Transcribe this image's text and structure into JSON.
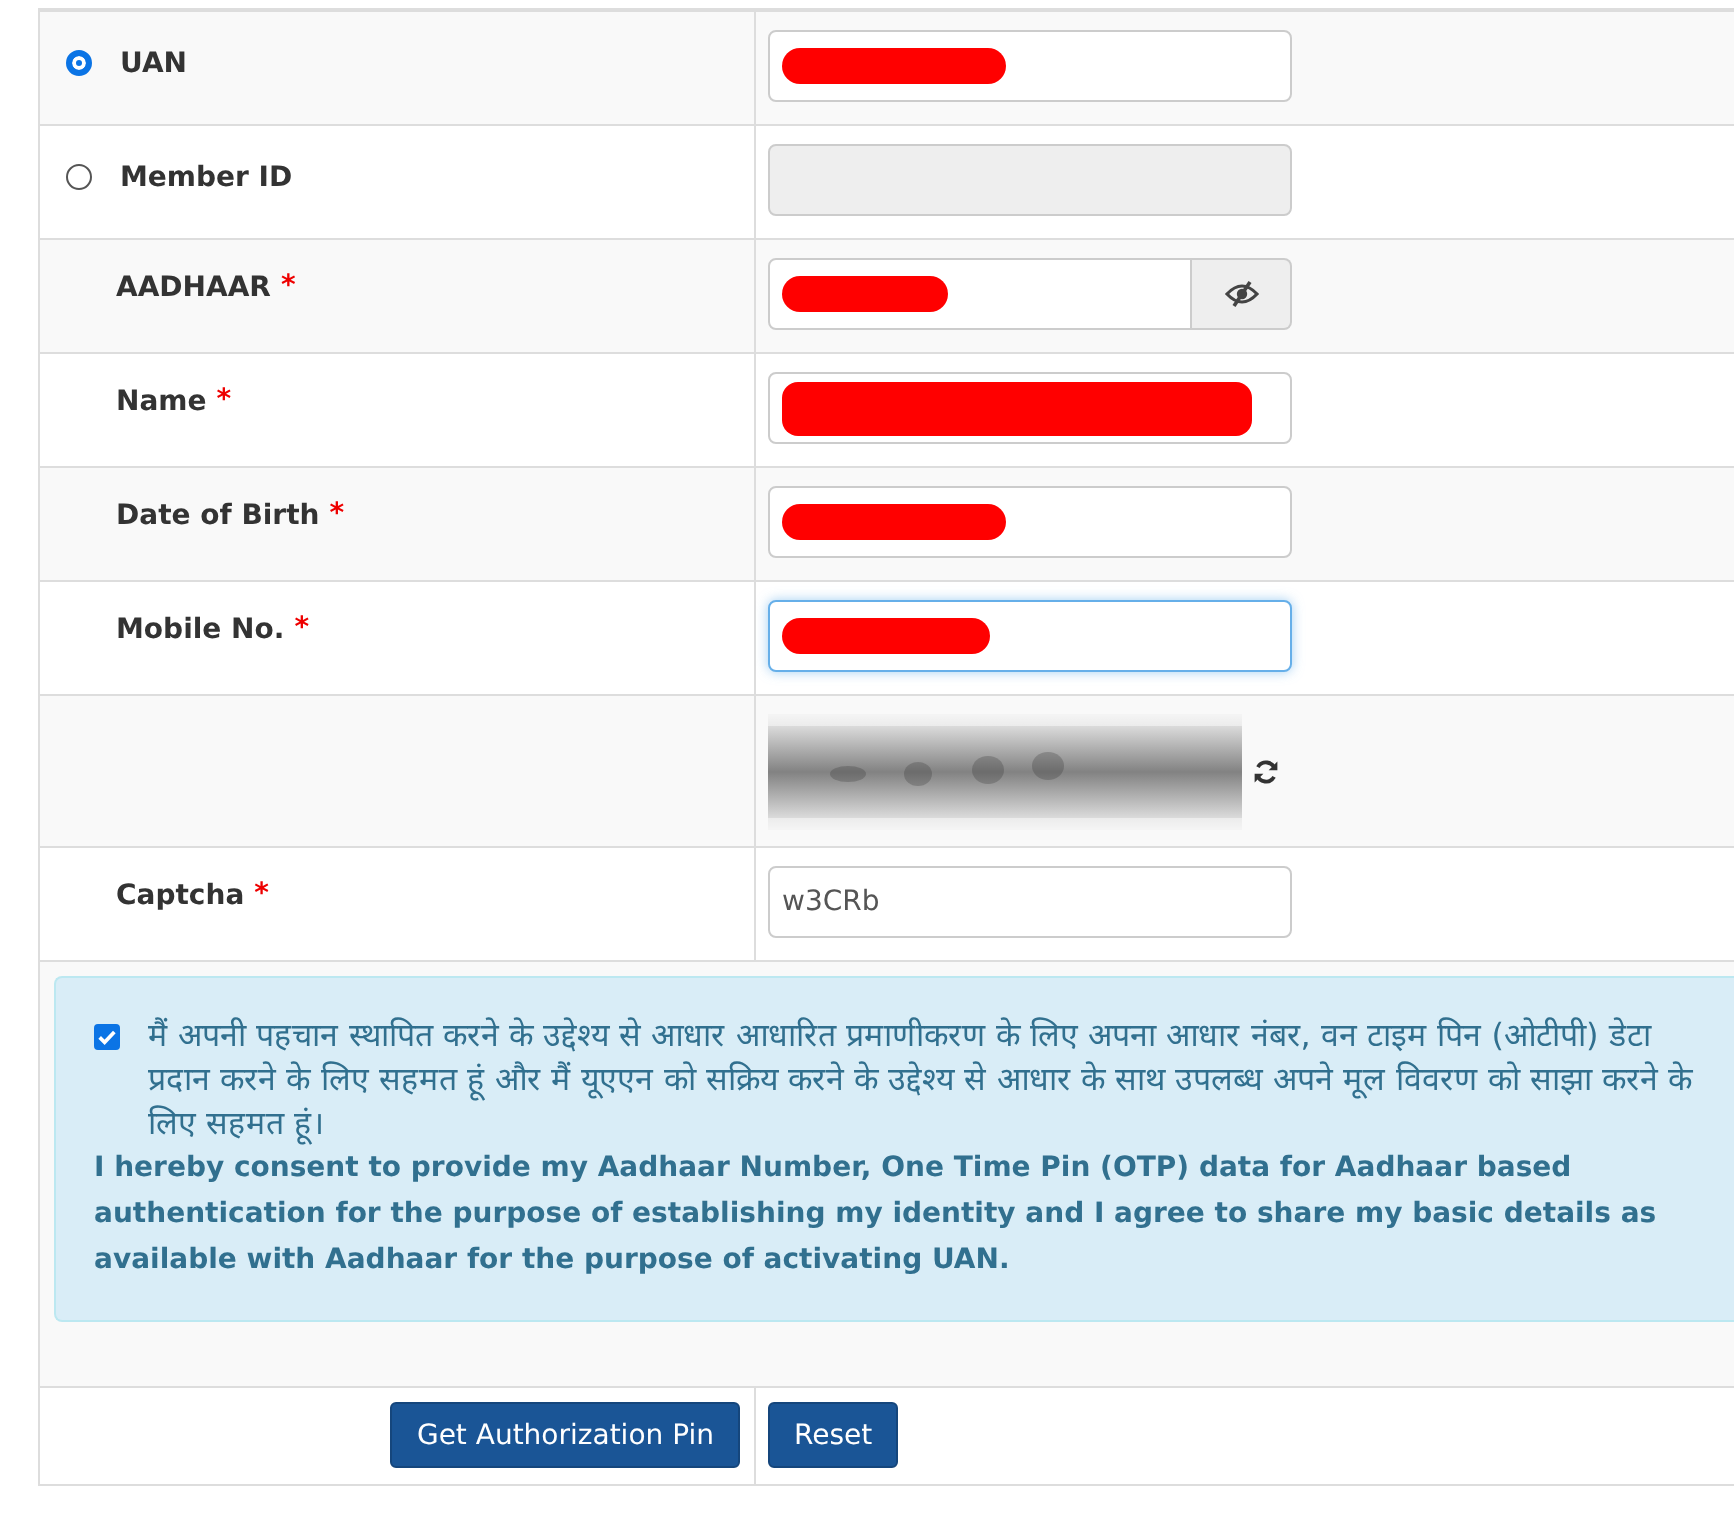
{
  "rows": [
    {
      "kind": "radio",
      "label": "UAN",
      "selected": true,
      "input": {
        "redacted": true,
        "disabled": false,
        "focused": false,
        "eye_toggle": false
      }
    },
    {
      "kind": "radio",
      "label": "Member ID",
      "selected": false,
      "input": {
        "redacted": false,
        "disabled": true,
        "focused": false,
        "eye_toggle": false
      }
    },
    {
      "kind": "required",
      "label": "AADHAAR",
      "mark": "*",
      "input": {
        "redacted": true,
        "disabled": false,
        "focused": false,
        "eye_toggle": true
      }
    },
    {
      "kind": "required",
      "label": "Name",
      "mark": "*",
      "input": {
        "redacted": true,
        "disabled": false,
        "focused": false,
        "eye_toggle": false
      }
    },
    {
      "kind": "required",
      "label": "Date of Birth",
      "mark": "*",
      "input": {
        "redacted": true,
        "disabled": false,
        "focused": false,
        "eye_toggle": false
      }
    },
    {
      "kind": "required",
      "label": "Mobile No.",
      "mark": "*",
      "input": {
        "redacted": true,
        "disabled": false,
        "focused": true,
        "eye_toggle": false
      }
    },
    {
      "kind": "captcha_image"
    },
    {
      "kind": "required",
      "label": "Captcha",
      "mark": "*",
      "input": {
        "value": "w3CRb",
        "redacted": false,
        "disabled": false,
        "focused": false,
        "eye_toggle": false
      }
    }
  ],
  "consent": {
    "checked": true,
    "hindi": "मैं अपनी पहचान स्थापित करने के उद्देश्य से आधार आधारित प्रमाणीकरण के लिए अपना आधार नंबर, वन टाइम पिन (ओटीपी) डेटा प्रदान करने के लिए सहमत हूं और मैं यूएएन को सक्रिय करने के उद्देश्य से आधार के साथ उपलब्ध अपने मूल विवरण को साझा करने के लिए सहमत हूं।",
    "english": "I hereby consent to provide my Aadhaar Number, One Time Pin (OTP) data for Aadhaar based authentication for the purpose of establishing my identity and I agree to share my basic details as available with Aadhaar for the purpose of activating UAN."
  },
  "buttons": [
    "Get Authorization Pin",
    "Reset"
  ]
}
